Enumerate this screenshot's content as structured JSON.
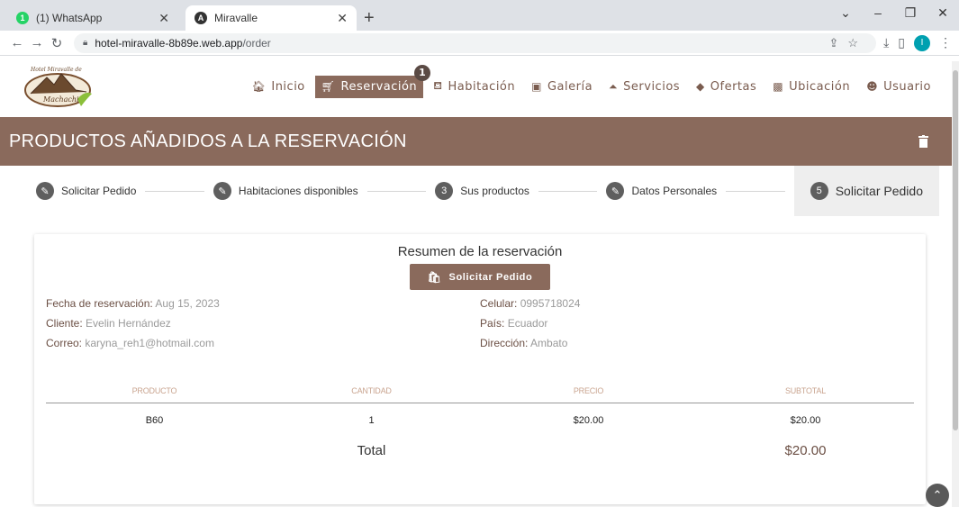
{
  "browser": {
    "tabs": [
      {
        "title": "(1) WhatsApp",
        "active": false,
        "favicon": "whatsapp-icon",
        "favicon_color": "#25d366",
        "favicon_text": "1"
      },
      {
        "title": "Miravalle",
        "active": true,
        "favicon": "angular-icon",
        "favicon_color": "#333333",
        "favicon_text": "A"
      }
    ],
    "url_host": "hotel-miravalle-8b89e.web.app",
    "url_path": "/order",
    "profile_initial": "I"
  },
  "logo": {
    "top_text": "Hotel Miravalle de",
    "bottom_text": "Machachi"
  },
  "nav": [
    {
      "label": "Inicio",
      "icon": "home-icon",
      "glyph": "🏠︎"
    },
    {
      "label": "Reservación",
      "icon": "cart-icon",
      "glyph": "🛒︎",
      "active": true,
      "badge": "1"
    },
    {
      "label": "Habitación",
      "icon": "bed-icon",
      "glyph": "⛾"
    },
    {
      "label": "Galería",
      "icon": "image-icon",
      "glyph": "▣"
    },
    {
      "label": "Servicios",
      "icon": "bell-icon",
      "glyph": "⏶"
    },
    {
      "label": "Ofertas",
      "icon": "tag-icon",
      "glyph": "◆"
    },
    {
      "label": "Ubicación",
      "icon": "map-icon",
      "glyph": "▩"
    },
    {
      "label": "Usuario",
      "icon": "user-icon",
      "glyph": "☻"
    }
  ],
  "banner": {
    "title": "PRODUCTOS AÑADIDOS A LA RESERVACIÓN"
  },
  "steps": [
    {
      "label": "Solicitar Pedido",
      "marker": "✎"
    },
    {
      "label": "Habitaciones disponibles",
      "marker": "✎"
    },
    {
      "label": "Sus productos",
      "marker": "3"
    },
    {
      "label": "Datos Personales",
      "marker": "✎"
    },
    {
      "label": "Solicitar Pedido",
      "marker": "5",
      "current": true
    }
  ],
  "summary": {
    "title": "Resumen de la reservación",
    "order_button": "Solicitar Pedido",
    "left": [
      {
        "label": "Fecha de reservación:",
        "value": "Aug 15, 2023"
      },
      {
        "label": "Cliente:",
        "value": "Evelin Hernández"
      },
      {
        "label": "Correo:",
        "value": "karyna_reh1@hotmail.com"
      }
    ],
    "right": [
      {
        "label": "Celular:",
        "value": "0995718024"
      },
      {
        "label": "País:",
        "value": "Ecuador"
      },
      {
        "label": "Dirección:",
        "value": "Ambato"
      }
    ]
  },
  "table": {
    "headers": [
      "PRODUCTO",
      "CANTIDAD",
      "PRECIO",
      "SUBTOTAL"
    ],
    "rows": [
      [
        "B60",
        "1",
        "$20.00",
        "$20.00"
      ]
    ],
    "total_label": "Total",
    "total_value": "$20.00"
  },
  "colors": {
    "brand": "#8a6a5c",
    "header_text": "#c9a48f"
  }
}
